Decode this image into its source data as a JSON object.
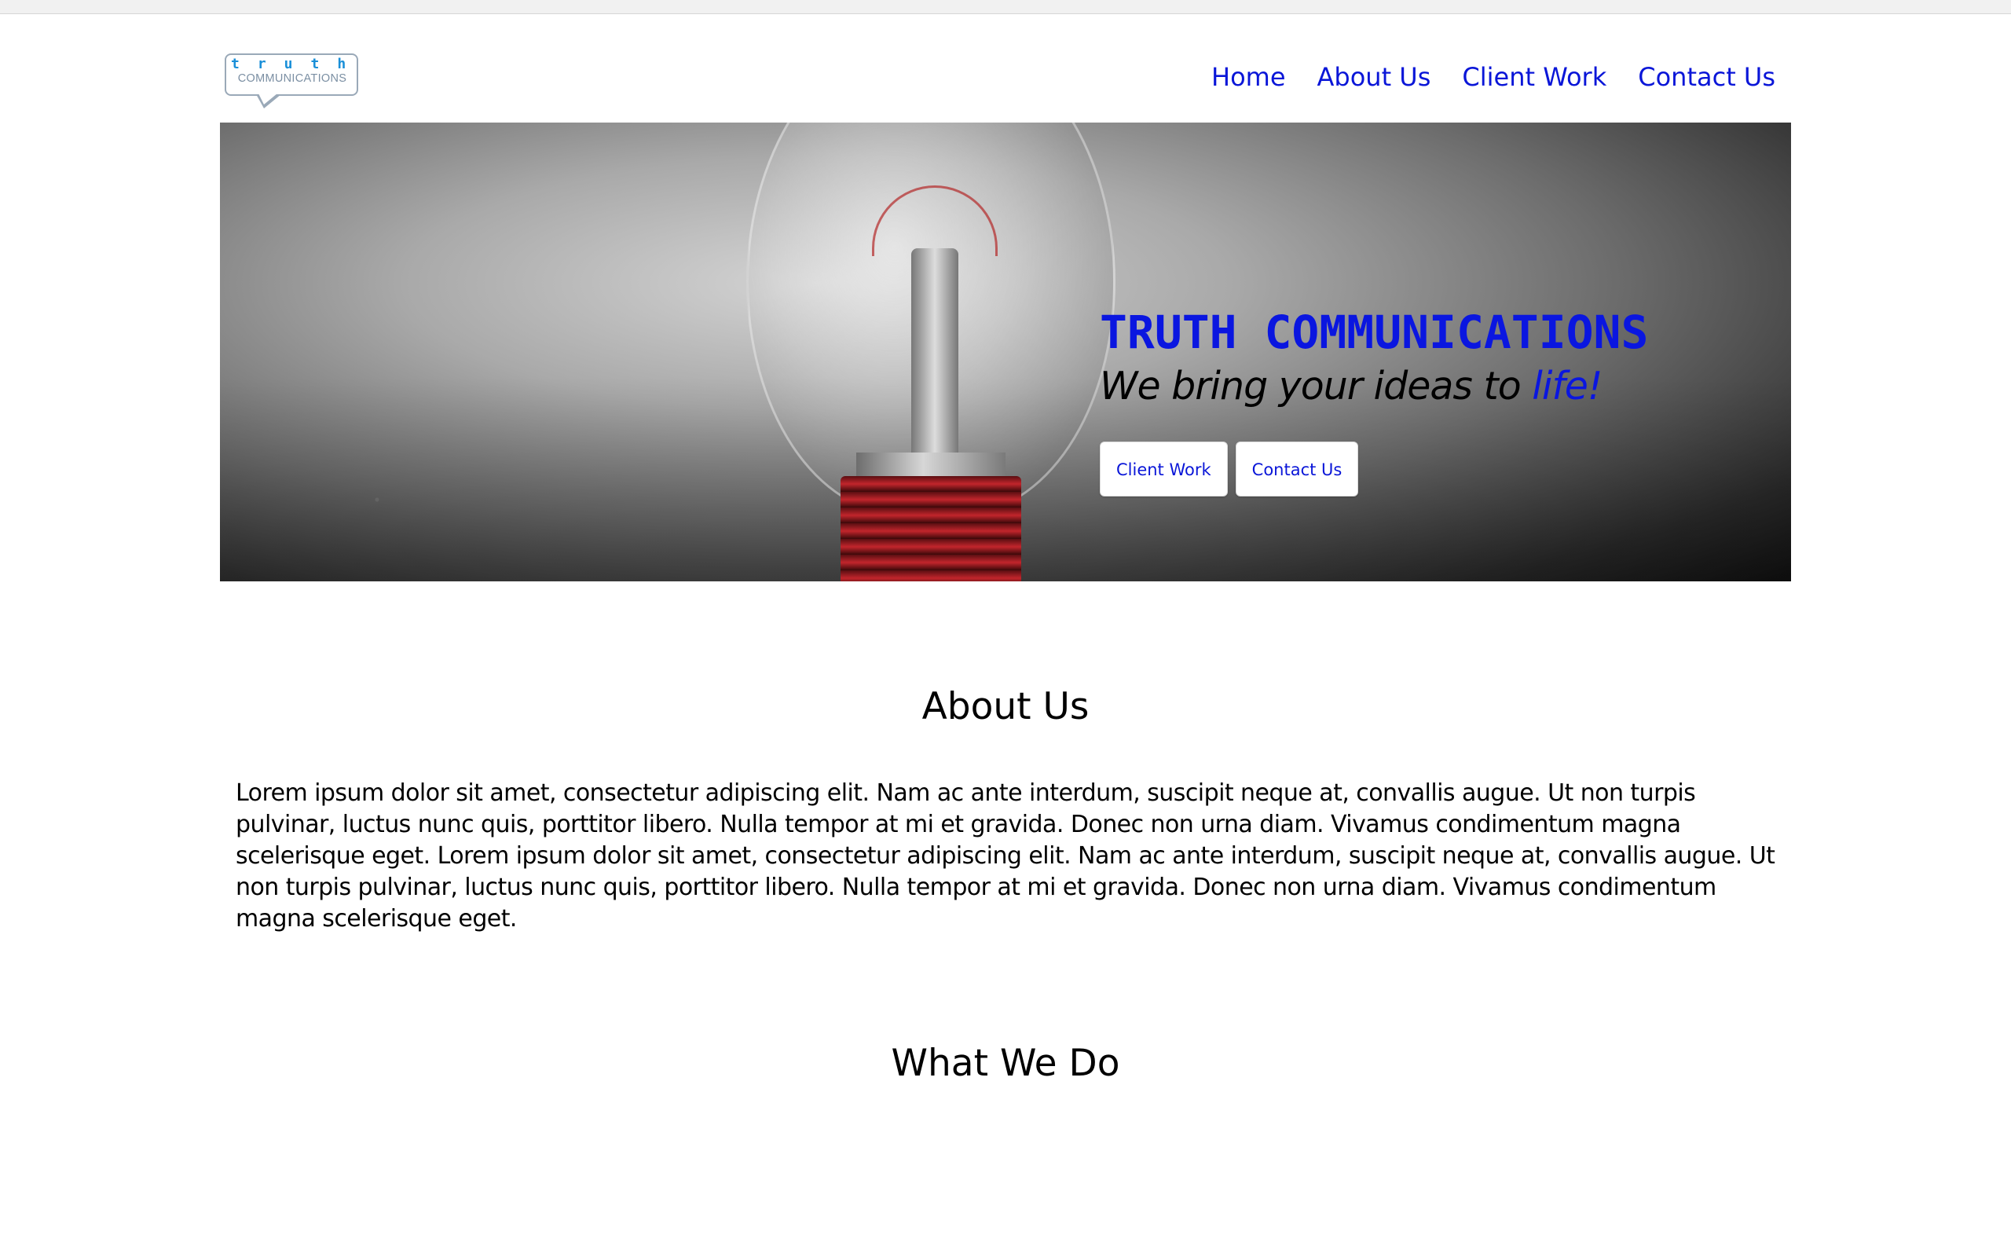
{
  "logo": {
    "word": "truth",
    "sub": "COMMUNICATIONS"
  },
  "nav": {
    "items": [
      "Home",
      "About Us",
      "Client Work",
      "Contact Us"
    ]
  },
  "hero": {
    "title": "TRUTH COMMUNICATIONS",
    "tagline_main": "We bring your ideas to ",
    "tagline_highlight": "life!",
    "buttons": [
      "Client Work",
      "Contact Us"
    ]
  },
  "about": {
    "title": "About Us",
    "body": "Lorem ipsum dolor sit amet, consectetur adipiscing elit. Nam ac ante interdum, suscipit neque at, convallis augue. Ut non turpis pulvinar, luctus nunc quis, porttitor libero. Nulla tempor at mi et gravida. Donec non urna diam. Vivamus condimentum magna scelerisque eget. Lorem ipsum dolor sit amet, consectetur adipiscing elit. Nam ac ante interdum, suscipit neque at, convallis augue. Ut non turpis pulvinar, luctus nunc quis, porttitor libero. Nulla tempor at mi et gravida. Donec non urna diam. Vivamus condimentum magna scelerisque eget."
  },
  "whatwedo": {
    "title": "What We Do"
  },
  "colors": {
    "accent": "#0a16d8",
    "text": "#000000",
    "background": "#ffffff"
  }
}
